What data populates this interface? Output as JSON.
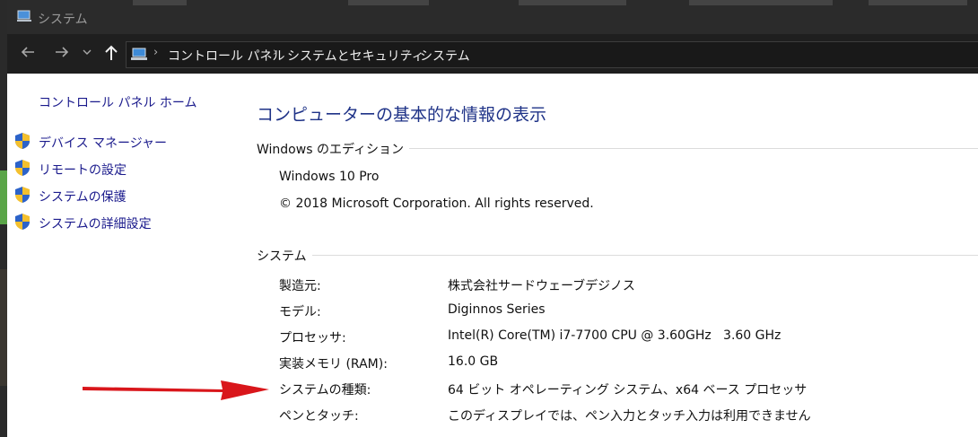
{
  "window": {
    "title": "システム"
  },
  "address_bar": {
    "crumbs": [
      "コントロール パネル",
      "システムとセキュリティ",
      "システム"
    ]
  },
  "sidebar": {
    "home_link": "コントロール パネル ホーム",
    "links": [
      "デバイス マネージャー",
      "リモートの設定",
      "システムの保護",
      "システムの詳細設定"
    ]
  },
  "main": {
    "heading": "コンピューターの基本的な情報の表示",
    "edition_section": {
      "label": "Windows のエディション",
      "edition": "Windows 10 Pro",
      "copyright": "© 2018 Microsoft Corporation. All rights reserved."
    },
    "system_section": {
      "label": "システム",
      "rows": [
        {
          "label": "製造元:",
          "value": "株式会社サードウェーブデジノス"
        },
        {
          "label": "モデル:",
          "value": "Diginnos Series"
        },
        {
          "label": "プロセッサ:",
          "value": "Intel(R) Core(TM) i7-7700 CPU @ 3.60GHz   3.60 GHz"
        },
        {
          "label": "実装メモリ (RAM):",
          "value": "16.0 GB"
        },
        {
          "label": "システムの種類:",
          "value": "64 ビット オペレーティング システム、x64 ベース プロセッサ"
        },
        {
          "label": "ペンとタッチ:",
          "value": "このディスプレイでは、ペン入力とタッチ入力は利用できません"
        }
      ]
    }
  },
  "icons": {
    "back": "back-arrow-icon",
    "forward": "forward-arrow-icon",
    "recent": "chevron-down-icon",
    "up": "up-arrow-icon",
    "location": "computer-icon",
    "shield": "uac-shield-icon",
    "annotation": "red-arrow-annotation"
  },
  "colors": {
    "link": "#1a1a8c",
    "heading": "#1e3287",
    "arrow": "#d9161b",
    "titlebar": "#2b2b2b"
  }
}
